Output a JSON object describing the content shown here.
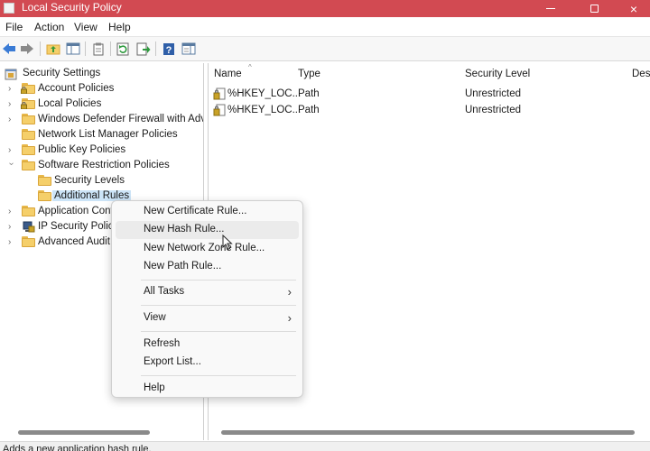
{
  "window": {
    "title": "Local Security Policy",
    "minimize_glyph": "minimize-icon",
    "maximize_glyph": "maximize-icon",
    "close_glyph": "×"
  },
  "menubar": {
    "file": "File",
    "action": "Action",
    "view": "View",
    "help": "Help"
  },
  "toolbar": {
    "icons": [
      "back-icon",
      "forward-icon",
      "up-folder-icon",
      "show-hide-tree-icon",
      "properties-icon",
      "refresh-icon",
      "export-list-icon",
      "help-icon",
      "show-action-pane-icon"
    ]
  },
  "tree": {
    "root": "Security Settings",
    "items": [
      {
        "label": "Account Policies"
      },
      {
        "label": "Local Policies"
      },
      {
        "label": "Windows Defender Firewall with Advan"
      },
      {
        "label": "Network List Manager Policies"
      },
      {
        "label": "Public Key Policies"
      },
      {
        "label": "Software Restriction Policies"
      },
      {
        "label": "Security Levels"
      },
      {
        "label": "Additional Rules"
      },
      {
        "label": "Application Cont"
      },
      {
        "label": "IP Security Policie"
      },
      {
        "label": "Advanced Audit I"
      }
    ]
  },
  "list": {
    "columns": {
      "name": "Name",
      "type": "Type",
      "security_level": "Security Level",
      "description": "Des"
    },
    "rows": [
      {
        "name": "%HKEY_LOC...",
        "type": "Path",
        "security_level": "Unrestricted"
      },
      {
        "name": "%HKEY_LOC...",
        "type": "Path",
        "security_level": "Unrestricted"
      }
    ]
  },
  "context_menu": {
    "items": [
      {
        "label": "New Certificate Rule..."
      },
      {
        "label": "New Hash Rule..."
      },
      {
        "label": "New Network Zone Rule..."
      },
      {
        "label": "New Path Rule..."
      },
      {
        "label": "All Tasks"
      },
      {
        "label": "View"
      },
      {
        "label": "Refresh"
      },
      {
        "label": "Export List..."
      },
      {
        "label": "Help"
      }
    ],
    "submenu_arrow": "›"
  },
  "status": {
    "text": "Adds a new application hash rule."
  },
  "colors": {
    "titlebar": "#d24a52",
    "selection": "#cce4f7",
    "folder": "#f5cf6a"
  }
}
